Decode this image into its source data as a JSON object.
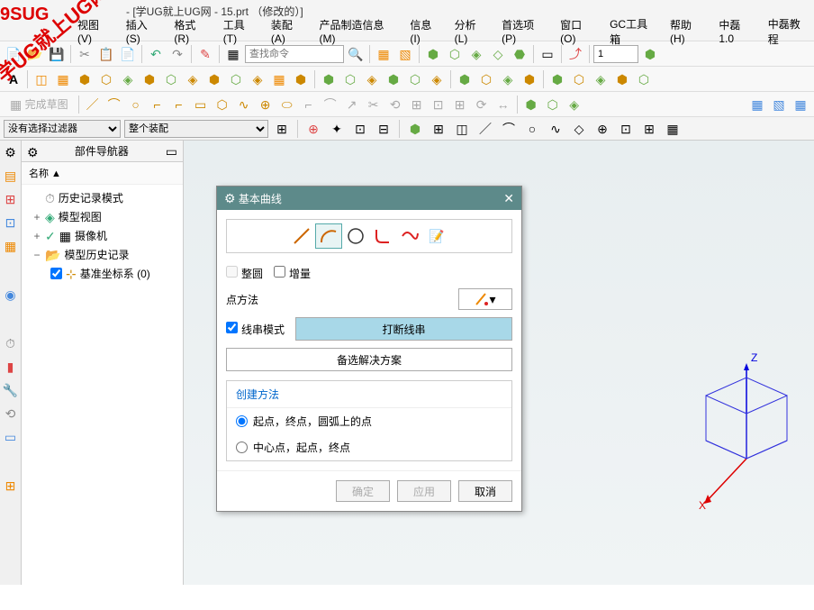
{
  "title": "- [学UG就上UG网 - 15.prt （修改的）]",
  "watermark": "学UG就上UG网",
  "watermark2": "9SUG",
  "menu": [
    "视图(V)",
    "插入(S)",
    "格式(R)",
    "工具(T)",
    "装配(A)",
    "产品制造信息(M)",
    "信息(I)",
    "分析(L)",
    "首选项(P)",
    "窗口(O)",
    "GC工具箱",
    "帮助(H)",
    "中磊1.0",
    "中磊教程"
  ],
  "search_placeholder": "查找命令",
  "spinner_value": "1",
  "sketch_label": "完成草图",
  "filter1": "没有选择过滤器",
  "filter2": "整个装配",
  "navigator": {
    "title": "部件导航器",
    "column": "名称  ▲",
    "items": [
      {
        "label": "历史记录模式",
        "icon": "⏱"
      },
      {
        "label": "模型视图",
        "icon": "◈",
        "exp": "+"
      },
      {
        "label": "摄像机",
        "icon": "✓",
        "exp": "+"
      },
      {
        "label": "模型历史记录",
        "icon": "📁",
        "exp": "−"
      }
    ],
    "sub": {
      "label": "基准坐标系 (0)",
      "checked": true
    }
  },
  "dialog": {
    "title": "基本曲线",
    "cb_round": "整圆",
    "cb_incr": "增量",
    "point_method": "点方法",
    "cb_string": "线串模式",
    "btn_break": "打断线串",
    "btn_alt": "备选解决方案",
    "group_title": "创建方法",
    "radio1": "起点，终点，圆弧上的点",
    "radio2": "中心点，起点，终点",
    "btn_ok": "确定",
    "btn_apply": "应用",
    "btn_cancel": "取消"
  },
  "axes": {
    "x": "X",
    "z": "Z"
  }
}
